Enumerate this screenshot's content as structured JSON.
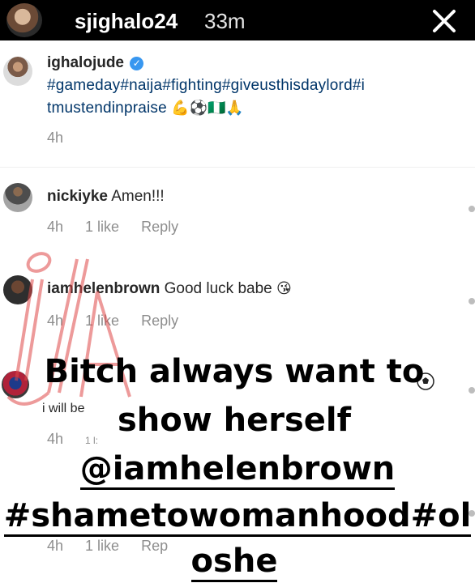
{
  "story": {
    "username": "sjighalo24",
    "time": "33m"
  },
  "post": {
    "username": "ighalojude",
    "hashtags_line1": "#gameday#naija#fighting#giveusthisdaylord#i",
    "hashtags_line2": "tmustendinpraise",
    "emojis": "💪⚽🇳🇬🙏",
    "age": "4h"
  },
  "comments": [
    {
      "username": "nickiyke",
      "text": "Amen!!!",
      "age": "4h",
      "likes": "1 like",
      "reply": "Reply"
    },
    {
      "username": "iamhelenbrown",
      "text": "Good luck babe",
      "emoji": "😘",
      "age": "4h",
      "likes": "1 like",
      "reply": "Reply"
    },
    {
      "text": "i will be",
      "age": "4h",
      "likes": "1 l:"
    },
    {
      "age": "4h",
      "likes": "1 like",
      "reply": "Rep"
    }
  ],
  "overlay": {
    "line1": "Bitch always want to",
    "line2": "show herself",
    "line3": "@iamhelenbrown",
    "line4": "#shametowomanhood#ol",
    "line5": "oshe"
  },
  "watermark_text": "ija"
}
